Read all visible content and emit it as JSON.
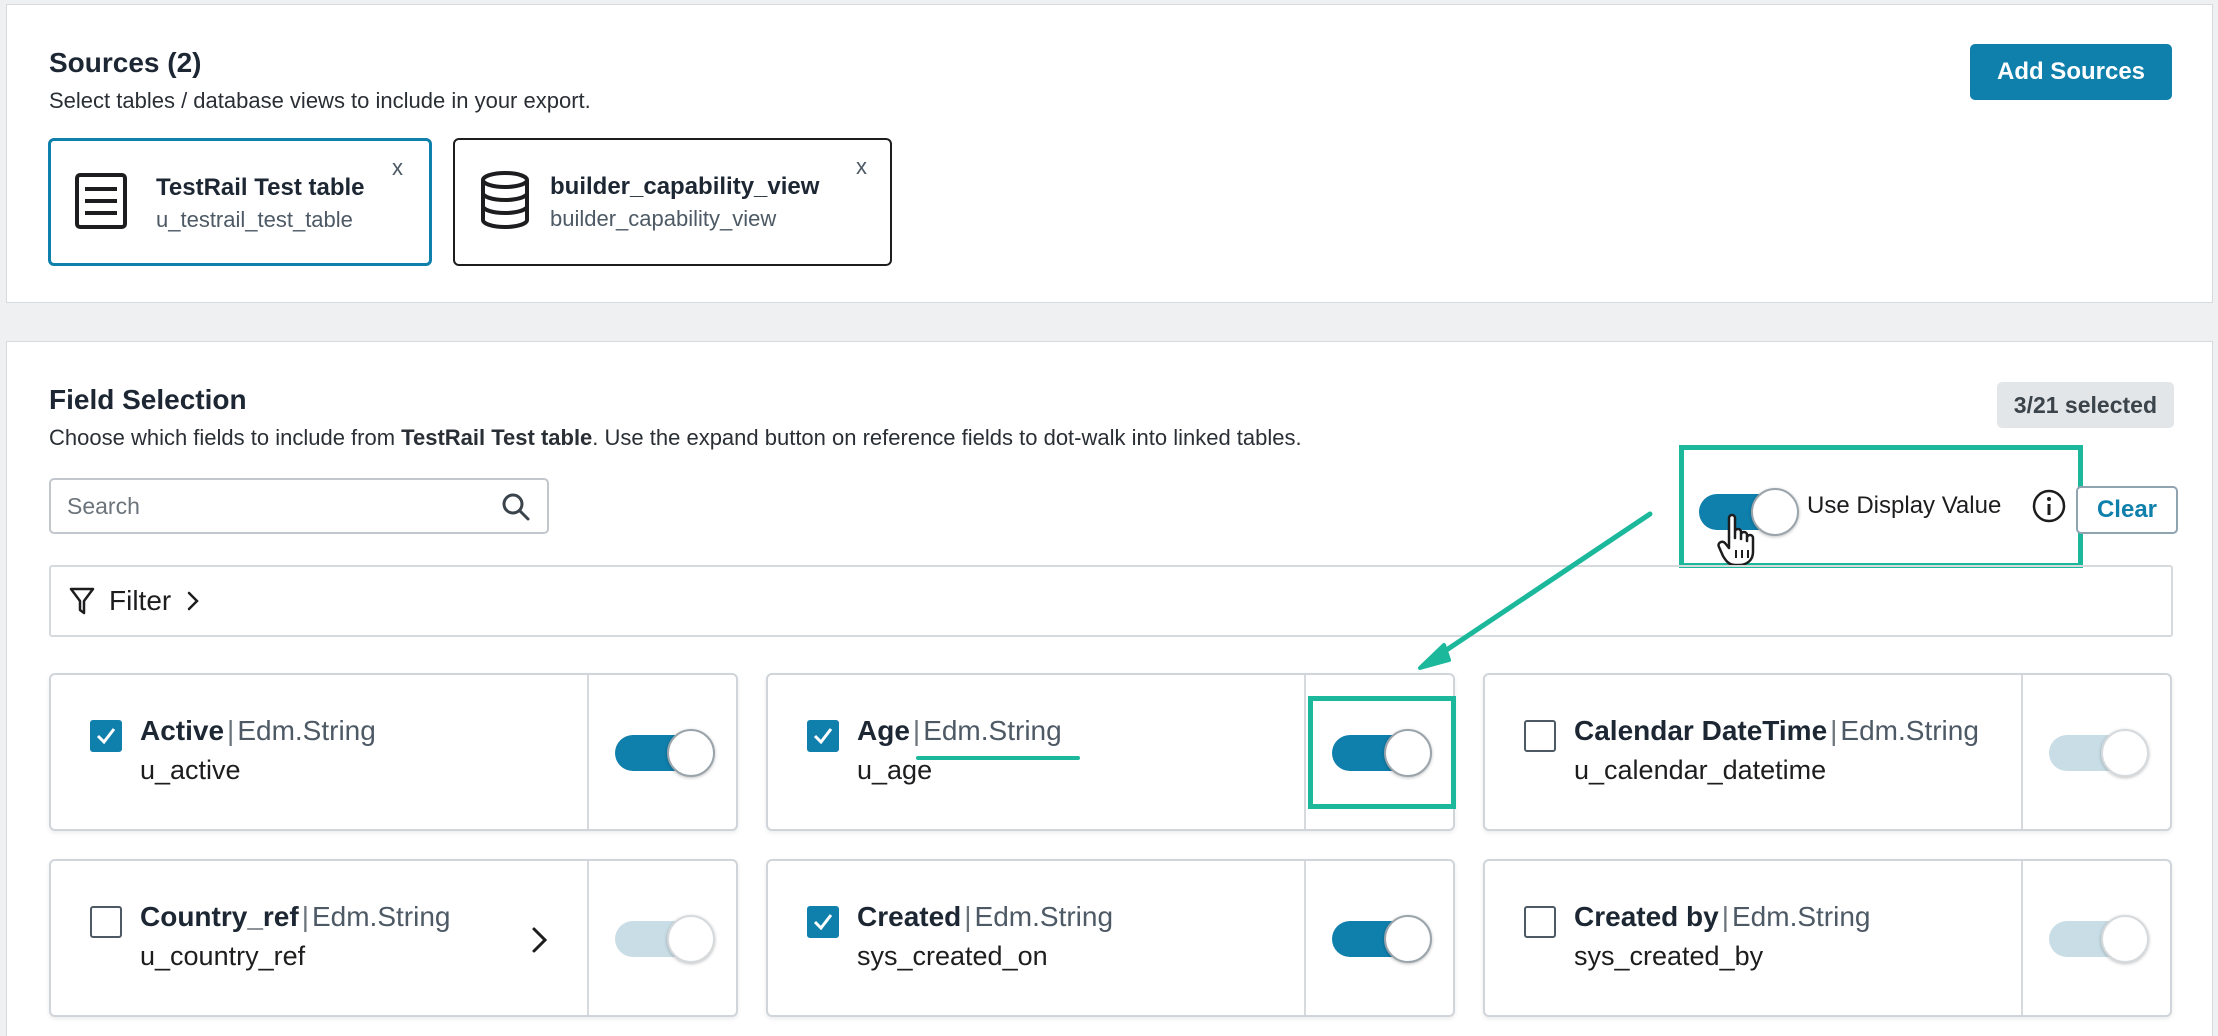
{
  "sources": {
    "title": "Sources (2)",
    "subtitle": "Select tables / database views to include in your export.",
    "add_button": "Add Sources",
    "cards": [
      {
        "title": "TestRail Test table",
        "subtitle": "u_testrail_test_table",
        "icon": "table-list-icon",
        "close": "x"
      },
      {
        "title": "builder_capability_view",
        "subtitle": "builder_capability_view",
        "icon": "database-icon",
        "close": "x"
      }
    ]
  },
  "fields": {
    "title": "Field Selection",
    "subtitle_pre": "Choose which fields to include from ",
    "subtitle_table": "TestRail Test table",
    "subtitle_post": ". Use the expand button on reference fields to dot-walk into linked tables.",
    "selected_badge": "3/21 selected",
    "search": {
      "placeholder": "Search",
      "value": ""
    },
    "display_value_label": "Use Display Value",
    "display_value_enabled": true,
    "clear_button": "Clear",
    "filter_label": "Filter",
    "sep": "|",
    "items": [
      {
        "label": "Active",
        "type": "Edm.String",
        "key": "u_active",
        "checked": true,
        "display_toggle": true,
        "expandable": false
      },
      {
        "label": "Age",
        "type": "Edm.String",
        "key": "u_age",
        "checked": true,
        "display_toggle": true,
        "expandable": false
      },
      {
        "label": "Calendar DateTime",
        "type": "Edm.String",
        "key": "u_calendar_datetime",
        "checked": false,
        "display_toggle": false,
        "expandable": false
      },
      {
        "label": "Country_ref",
        "type": "Edm.String",
        "key": "u_country_ref",
        "checked": false,
        "display_toggle": false,
        "expandable": true
      },
      {
        "label": "Created",
        "type": "Edm.String",
        "key": "sys_created_on",
        "checked": true,
        "display_toggle": true,
        "expandable": false
      },
      {
        "label": "Created by",
        "type": "Edm.String",
        "key": "sys_created_by",
        "checked": false,
        "display_toggle": false,
        "expandable": false
      }
    ]
  },
  "colors": {
    "accent": "#0f7fac",
    "annotation": "#1bb89c",
    "toggle_off": "#c8dde6"
  }
}
